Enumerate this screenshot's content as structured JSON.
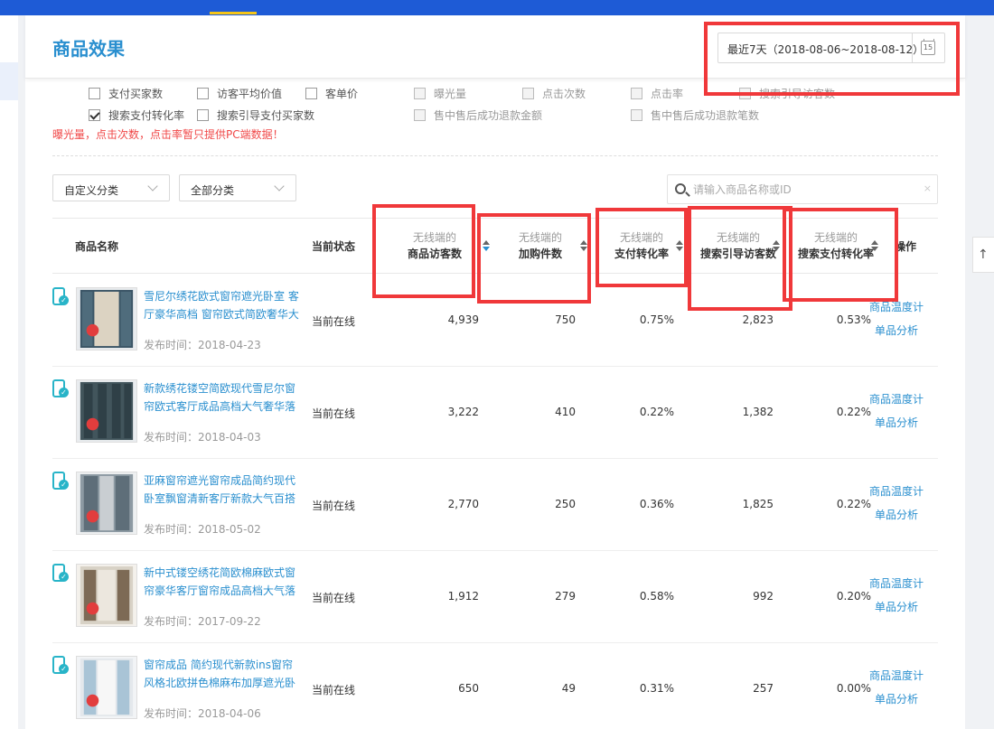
{
  "page": {
    "title": "商品效果",
    "date_range": "最近7天（2018-08-06~2018-08-12）",
    "calendar_day": "15"
  },
  "metrics": [
    {
      "label": "支付买家数",
      "checked": false,
      "disabled": false
    },
    {
      "label": "访客平均价值",
      "checked": false,
      "disabled": false
    },
    {
      "label": "客单价",
      "checked": false,
      "disabled": false
    },
    {
      "label": "曝光量",
      "checked": false,
      "disabled": true
    },
    {
      "label": "点击次数",
      "checked": false,
      "disabled": true
    },
    {
      "label": "点击率",
      "checked": false,
      "disabled": true
    },
    {
      "label": "搜索引导访客数",
      "checked": false,
      "disabled": true
    },
    {
      "label": "搜索支付转化率",
      "checked": true,
      "disabled": false
    },
    {
      "label": "搜索引导支付买家数",
      "checked": false,
      "disabled": false
    },
    {
      "label": "售中售后成功退款金额",
      "checked": false,
      "disabled": true
    },
    {
      "label": "售中售后成功退款笔数",
      "checked": false,
      "disabled": true
    }
  ],
  "notice": "曝光量，点击次数，点击率暂只提供PC端数据！",
  "filters": {
    "custom_category": "自定义分类",
    "all_category": "全部分类",
    "search_placeholder": "请输入商品名称或ID",
    "clear_icon": "×"
  },
  "table": {
    "headers": {
      "name": "商品名称",
      "status": "当前状态",
      "visitors_sub": "无线端的",
      "visitors": "商品访客数",
      "cart_sub": "无线端的",
      "cart": "加购件数",
      "pay_rate_sub": "无线端的",
      "pay_rate": "支付转化率",
      "search_visitors_sub": "无线端的",
      "search_visitors": "搜索引导访客数",
      "search_pay_rate_sub": "无线端的",
      "search_pay_rate": "搜索支付转化率",
      "ops": "操作"
    },
    "rows": [
      {
        "title": "雪尼尔绣花欧式窗帘遮光卧室 客厅豪华高档 窗帘欧式简欧奢华大",
        "date": "发布时间：2018-04-23",
        "status": "当前在线",
        "visitors": "4,939",
        "cart": "750",
        "pay_rate": "0.75%",
        "search_visitors": "2,823",
        "search_pay_rate": "0.53%",
        "op1": "商品温度计",
        "op2": "单品分析"
      },
      {
        "title": "新款绣花镂空简欧现代雪尼尔窗帘欧式客厅成品高档大气奢华落",
        "date": "发布时间：2018-04-03",
        "status": "当前在线",
        "visitors": "3,222",
        "cart": "410",
        "pay_rate": "0.22%",
        "search_visitors": "1,382",
        "search_pay_rate": "0.22%",
        "op1": "商品温度计",
        "op2": "单品分析"
      },
      {
        "title": "亚麻窗帘遮光窗帘成品简约现代卧室飘窗清新客厅新款大气百搭",
        "date": "发布时间：2018-05-02",
        "status": "当前在线",
        "visitors": "2,770",
        "cart": "250",
        "pay_rate": "0.36%",
        "search_visitors": "1,825",
        "search_pay_rate": "0.22%",
        "op1": "商品温度计",
        "op2": "单品分析"
      },
      {
        "title": "新中式镂空绣花简欧棉麻欧式窗帘豪华客厅窗帘成品高档大气落",
        "date": "发布时间：2017-09-22",
        "status": "当前在线",
        "visitors": "1,912",
        "cart": "279",
        "pay_rate": "0.58%",
        "search_visitors": "992",
        "search_pay_rate": "0.20%",
        "op1": "商品温度计",
        "op2": "单品分析"
      },
      {
        "title": "窗帘成品 简约现代新款ins窗帘风格北欧拼色棉麻布加厚遮光卧",
        "date": "发布时间：2018-04-06",
        "status": "当前在线",
        "visitors": "650",
        "cart": "49",
        "pay_rate": "0.31%",
        "search_visitors": "257",
        "search_pay_rate": "0.00%",
        "op1": "商品温度计",
        "op2": "单品分析"
      }
    ]
  },
  "back_top_icon": "↑",
  "colors": {
    "brand_blue": "#1e5bd6",
    "link_blue": "#2a8fcf",
    "annotation_red": "#f0383a",
    "warning_red": "#f04848"
  }
}
